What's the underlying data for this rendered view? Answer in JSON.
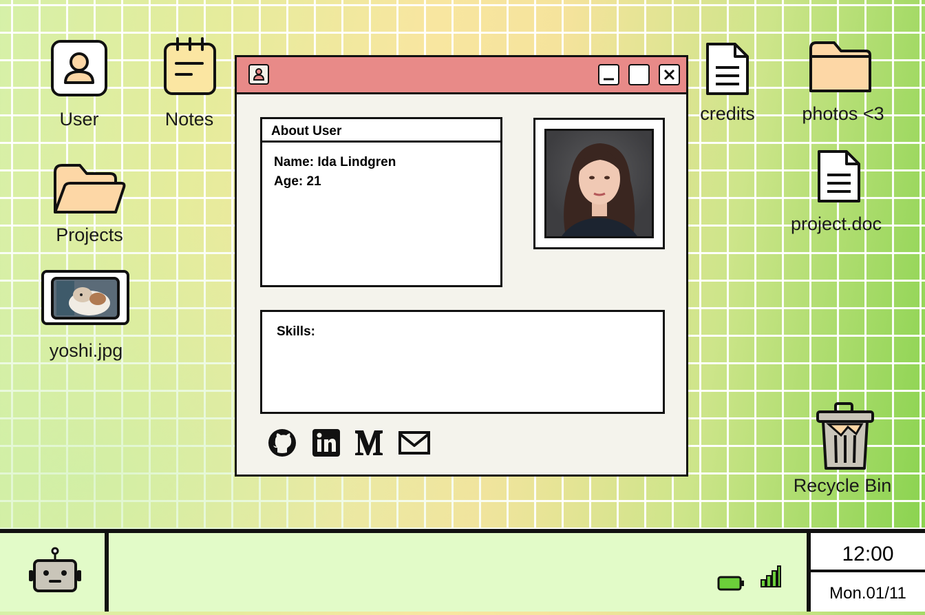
{
  "desktop": {
    "icons": [
      {
        "label": "User"
      },
      {
        "label": "Notes"
      },
      {
        "label": "Projects"
      },
      {
        "label": "yoshi.jpg"
      },
      {
        "label": "credits"
      },
      {
        "label": "photos <3"
      },
      {
        "label": "project.doc"
      },
      {
        "label": "Recycle Bin"
      }
    ]
  },
  "window": {
    "about_title": "About User",
    "name_line": "Name: Ida Lindgren",
    "age_line": "Age: 21",
    "skills_label": "Skills:"
  },
  "social": [
    "github-icon",
    "linkedin-icon",
    "medium-icon",
    "mail-icon"
  ],
  "taskbar": {
    "time": "12:00",
    "date": "Mon.01/11"
  },
  "colors": {
    "titlebar": "#e88a88",
    "folder": "#fdd7a6",
    "window_bg": "#f4f3ec",
    "taskbar_bg": "#e2fbc8",
    "battery": "#6ccf3a"
  }
}
